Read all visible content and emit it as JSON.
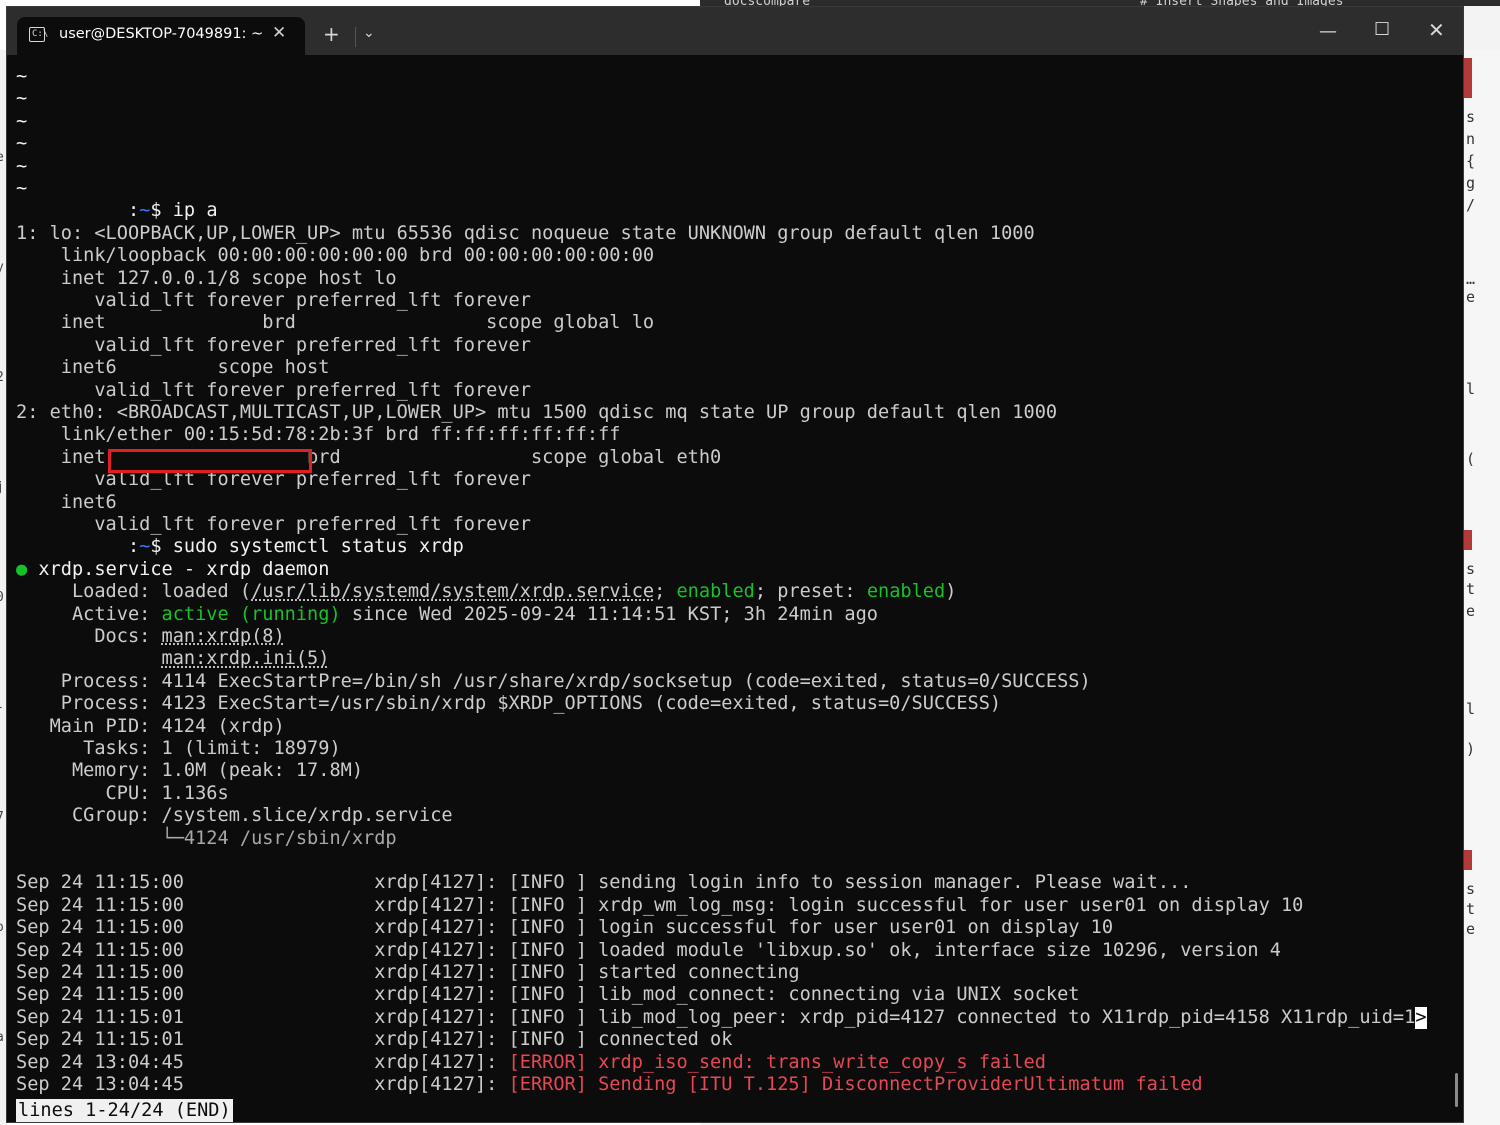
{
  "background_window": {
    "top_texts": [
      "docscompare",
      "# Insert Shapes and Images"
    ],
    "right_chars": [
      "s",
      "n",
      "{",
      "g",
      "/",
      "…",
      "e",
      "l",
      "(",
      "s",
      "t",
      "e",
      "l",
      ")",
      "s",
      "t",
      "e"
    ],
    "left_chars": [
      "e",
      "y",
      "2",
      "j",
      "0",
      "-",
      "7",
      "o",
      "a"
    ]
  },
  "titlebar": {
    "tab_title": "user@DESKTOP-7049891: ~",
    "tab_icon_glyph": "C:\\",
    "close_tab_icon": "✕",
    "new_tab_icon": "+",
    "dropdown_icon": "⌄",
    "minimize_icon": "—",
    "maximize_icon": "☐",
    "close_window_icon": "✕"
  },
  "terminal": {
    "lines": [
      [
        {
          "t": "~",
          "c": "white"
        }
      ],
      [
        {
          "t": "~",
          "c": "white"
        }
      ],
      [
        {
          "t": "~",
          "c": "white"
        }
      ],
      [
        {
          "t": "~",
          "c": "white"
        }
      ],
      [
        {
          "t": "~",
          "c": "white"
        }
      ],
      [
        {
          "t": "~",
          "c": "white"
        }
      ],
      [
        {
          "t": "          :",
          "c": "white"
        },
        {
          "t": "~",
          "c": "blue"
        },
        {
          "t": "$ ip a",
          "c": "white"
        }
      ],
      [
        {
          "t": "1: lo: <LOOPBACK,UP,LOWER_UP> mtu 65536 qdisc noqueue state UNKNOWN group default qlen 1000"
        }
      ],
      [
        {
          "t": "    link/loopback 00:00:00:00:00:00 brd 00:00:00:00:00:00"
        }
      ],
      [
        {
          "t": "    inet 127.0.0.1/8 scope host lo"
        }
      ],
      [
        {
          "t": "       valid_lft forever preferred_lft forever"
        }
      ],
      [
        {
          "t": "    inet              brd                 scope global lo"
        }
      ],
      [
        {
          "t": "       valid_lft forever preferred_lft forever"
        }
      ],
      [
        {
          "t": "    inet6         scope host"
        }
      ],
      [
        {
          "t": "       valid_lft forever preferred_lft forever"
        }
      ],
      [
        {
          "t": "2: eth0: <BROADCAST,MULTICAST,UP,LOWER_UP> mtu 1500 qdisc mq state UP group default qlen 1000"
        }
      ],
      [
        {
          "t": "    link/ether 00:15:5d:78:2b:3f brd ff:ff:ff:ff:ff:ff"
        }
      ],
      [
        {
          "t": "    inet                  brd                 scope global eth0"
        }
      ],
      [
        {
          "t": "       valid_lft forever preferred_lft forever"
        }
      ],
      [
        {
          "t": "    inet6"
        }
      ],
      [
        {
          "t": "       valid_lft forever preferred_lft forever"
        }
      ],
      [
        {
          "t": "          :",
          "c": "white"
        },
        {
          "t": "~",
          "c": "blue"
        },
        {
          "t": "$ sudo systemctl status xrdp",
          "c": "white"
        }
      ],
      [
        {
          "t": "●",
          "c": "green"
        },
        {
          "t": " xrdp.service - xrdp daemon",
          "c": "white"
        }
      ],
      [
        {
          "t": "     Loaded: loaded ("
        },
        {
          "t": "/usr/lib/systemd/system/xrdp.service",
          "u": true
        },
        {
          "t": "; "
        },
        {
          "t": "enabled",
          "c": "green"
        },
        {
          "t": "; preset: "
        },
        {
          "t": "enabled",
          "c": "green"
        },
        {
          "t": ")"
        }
      ],
      [
        {
          "t": "     Active: "
        },
        {
          "t": "active (running)",
          "c": "green"
        },
        {
          "t": " since Wed 2025-09-24 11:14:51 KST; 3h 24min ago"
        }
      ],
      [
        {
          "t": "       Docs: "
        },
        {
          "t": "man:xrdp(8)",
          "u": true
        }
      ],
      [
        {
          "t": "             "
        },
        {
          "t": "man:xrdp.ini(5)",
          "u": true
        }
      ],
      [
        {
          "t": "    Process: 4114 ExecStartPre=/bin/sh /usr/share/xrdp/socksetup (code=exited, status=0/SUCCESS)"
        }
      ],
      [
        {
          "t": "    Process: 4123 ExecStart=/usr/sbin/xrdp $XRDP_OPTIONS (code=exited, status=0/SUCCESS)"
        }
      ],
      [
        {
          "t": "   Main PID: 4124 (xrdp)"
        }
      ],
      [
        {
          "t": "      Tasks: 1 (limit: 18979)"
        }
      ],
      [
        {
          "t": "     Memory: 1.0M (peak: 17.8M)"
        }
      ],
      [
        {
          "t": "        CPU: 1.136s"
        }
      ],
      [
        {
          "t": "     CGroup: /system.slice/xrdp.service"
        }
      ],
      [
        {
          "t": "             └─4124 /usr/sbin/xrdp",
          "c": "dim"
        }
      ],
      [
        {
          "t": ""
        }
      ],
      [
        {
          "t": "Sep 24 11:15:00                 xrdp[4127]: [INFO ] sending login info to session manager. Please wait..."
        }
      ],
      [
        {
          "t": "Sep 24 11:15:00                 xrdp[4127]: [INFO ] xrdp_wm_log_msg: login successful for user user01 on display 10"
        }
      ],
      [
        {
          "t": "Sep 24 11:15:00                 xrdp[4127]: [INFO ] login successful for user user01 on display 10"
        }
      ],
      [
        {
          "t": "Sep 24 11:15:00                 xrdp[4127]: [INFO ] loaded module 'libxup.so' ok, interface size 10296, version 4"
        }
      ],
      [
        {
          "t": "Sep 24 11:15:00                 xrdp[4127]: [INFO ] started connecting"
        }
      ],
      [
        {
          "t": "Sep 24 11:15:00                 xrdp[4127]: [INFO ] lib_mod_connect: connecting via UNIX socket"
        }
      ],
      [
        {
          "t": "Sep 24 11:15:01                 xrdp[4127]: [INFO ] lib_mod_log_peer: xrdp_pid=4127 connected to X11rdp_pid=4158 X11rdp_uid=1"
        },
        {
          "t": ">",
          "cursor": true
        }
      ],
      [
        {
          "t": "Sep 24 11:15:01                 xrdp[4127]: [INFO ] connected ok"
        }
      ],
      [
        {
          "t": "Sep 24 13:04:45                 xrdp[4127]: "
        },
        {
          "t": "[ERROR] xrdp_iso_send: trans_write_copy_s failed",
          "c": "red"
        }
      ],
      [
        {
          "t": "Sep 24 13:04:45                 xrdp[4127]: "
        },
        {
          "t": "[ERROR] Sending [ITU T.125] DisconnectProviderUltimatum failed",
          "c": "red"
        }
      ]
    ],
    "pager_status": "lines 1-24/24 (END)"
  }
}
